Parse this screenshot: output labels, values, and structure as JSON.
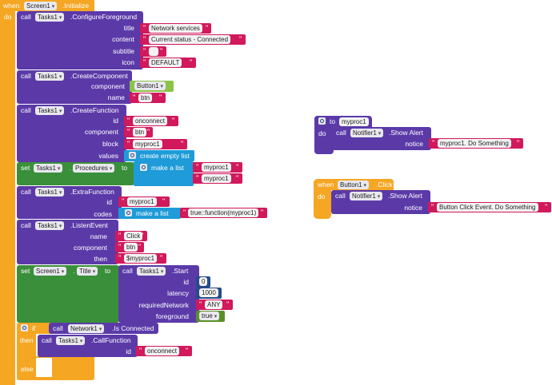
{
  "event_init": {
    "when": "when",
    "component": "Screen1",
    "event": ".Initialize",
    "do": "do"
  },
  "configure": {
    "call": "call",
    "component": "Tasks1",
    "method": ".ConfigureForeground",
    "labels": {
      "title": "title",
      "content": "content",
      "subtitle": "subtitle",
      "icon": "icon"
    },
    "values": {
      "title": "Network services",
      "content": "Current status - Connected",
      "subtitle": "",
      "icon": "DEFAULT"
    }
  },
  "create_component": {
    "call": "call",
    "component": "Tasks1",
    "method": ".CreateComponent",
    "labels": {
      "component": "component",
      "name": "name"
    },
    "values": {
      "component": "Button1",
      "name": "btn"
    }
  },
  "create_function": {
    "call": "call",
    "component": "Tasks1",
    "method": ".CreateFunction",
    "labels": {
      "id": "id",
      "component": "component",
      "block": "block",
      "values": "values"
    },
    "values": {
      "id": "onconnect",
      "component": "btn",
      "block": "myproc1",
      "values": "create empty list"
    }
  },
  "set_procedures": {
    "set": "set",
    "component": "Tasks1",
    "property": "Procedures",
    "to": "to",
    "make_list": "make a list",
    "items": [
      "myproc1",
      "myproc1"
    ]
  },
  "extra_function": {
    "call": "call",
    "component": "Tasks1",
    "method": ".ExtraFunction",
    "labels": {
      "id": "id",
      "codes": "codes"
    },
    "values": {
      "id": "myproc1",
      "make_list": "make a list",
      "code": "true::function(myproc1)"
    }
  },
  "listen_event": {
    "call": "call",
    "component": "Tasks1",
    "method": ".ListenEvent",
    "labels": {
      "name": "name",
      "component": "component",
      "then": "then"
    },
    "values": {
      "name": "Click",
      "component": "btn",
      "then": "$myproc1"
    }
  },
  "set_title": {
    "set": "set",
    "component": "Screen1",
    "property": "Title",
    "to": "to",
    "start": {
      "call": "call",
      "component": "Tasks1",
      "method": ".Start",
      "labels": {
        "id": "id",
        "latency": "latency",
        "requiredNetwork": "requiredNetwork",
        "foreground": "foreground"
      },
      "values": {
        "id": "0",
        "latency": "1000",
        "requiredNetwork": "ANY",
        "foreground": "true"
      }
    }
  },
  "if_block": {
    "if": "if",
    "then": "then",
    "else": "else",
    "cond": {
      "call": "call",
      "component": "Network1",
      "method": ".Is Connected"
    },
    "call_function": {
      "call": "call",
      "component": "Tasks1",
      "method": ".CallFunction",
      "id_label": "id",
      "id": "onconnect"
    }
  },
  "procedure": {
    "to": "to",
    "name": "myproc1",
    "do": "do",
    "call": {
      "call": "call",
      "component": "Notifier1",
      "method": ".Show Alert",
      "notice_label": "notice",
      "notice": "myproc1. Do Something"
    }
  },
  "button_click": {
    "when": "when",
    "component": "Button1",
    "event": ".Click",
    "do": "do",
    "call": {
      "call": "call",
      "component": "Notifier1",
      "method": ".Show Alert",
      "notice_label": "notice",
      "notice": "Button Click Event. Do Something"
    }
  },
  "colors": {
    "event": "#f5a623",
    "procedure_call": "#5b3aa8",
    "setter": "#3a8f3a",
    "text": "#d1195c",
    "list": "#1e9bd8",
    "number": "#274b8a",
    "component": "#8bc34a",
    "logic": "#5b8f2a"
  }
}
